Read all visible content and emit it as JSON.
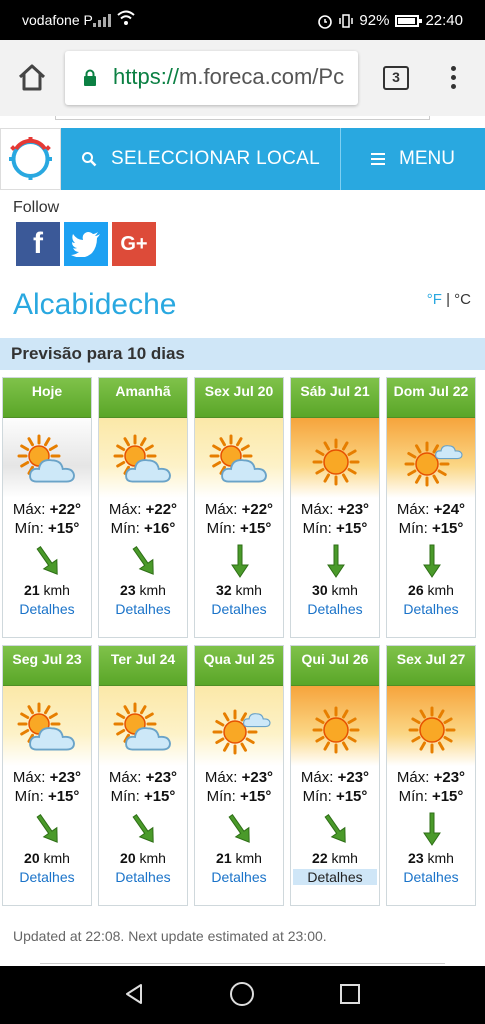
{
  "status": {
    "carrier": "vodafone P",
    "battery": "92%",
    "time": "22:40"
  },
  "browser": {
    "url_scheme": "https://",
    "url_host": "m.foreca.com/Pc",
    "tab_count": "3"
  },
  "site": {
    "select_location": "SELECCIONAR LOCAL",
    "menu": "MENU",
    "follow": "Follow",
    "social": {
      "facebook": "f",
      "google": "G+"
    },
    "city": "Alcabideche",
    "unit_f": "°F",
    "unit_sep": " | ",
    "unit_c": "°C",
    "section_title": "Previsão para 10 dias",
    "max_label": "Máx:",
    "min_label": "Mín:",
    "speed_unit": "kmh",
    "details": "Detalhes",
    "updated": "Updated at 22:08. Next update estimated at 23:00."
  },
  "forecast": [
    {
      "day": "Hoje",
      "max": "+22°",
      "min": "+15°",
      "wind": "21",
      "icon": "partly-cloudy-icon",
      "sky": "cloudy",
      "wind_dir": "nw"
    },
    {
      "day": "Amanhã",
      "max": "+22°",
      "min": "+16°",
      "wind": "23",
      "icon": "partly-cloudy-icon",
      "sky": "partly",
      "wind_dir": "nw"
    },
    {
      "day": "Sex Jul 20",
      "max": "+22°",
      "min": "+15°",
      "wind": "32",
      "icon": "partly-cloudy-icon",
      "sky": "partly",
      "wind_dir": "n"
    },
    {
      "day": "Sáb Jul 21",
      "max": "+23°",
      "min": "+15°",
      "wind": "30",
      "icon": "sunny-icon",
      "sky": "sunny",
      "wind_dir": "n"
    },
    {
      "day": "Dom Jul 22",
      "max": "+24°",
      "min": "+15°",
      "wind": "26",
      "icon": "mostly-sunny-icon",
      "sky": "sunny",
      "wind_dir": "n"
    },
    {
      "day": "Seg Jul 23",
      "max": "+23°",
      "min": "+15°",
      "wind": "20",
      "icon": "partly-cloudy-icon",
      "sky": "partly",
      "wind_dir": "nw"
    },
    {
      "day": "Ter Jul 24",
      "max": "+23°",
      "min": "+15°",
      "wind": "20",
      "icon": "partly-cloudy-icon",
      "sky": "partly",
      "wind_dir": "nw"
    },
    {
      "day": "Qua Jul 25",
      "max": "+23°",
      "min": "+15°",
      "wind": "21",
      "icon": "mostly-sunny-icon",
      "sky": "partly",
      "wind_dir": "nw"
    },
    {
      "day": "Qui Jul 26",
      "max": "+23°",
      "min": "+15°",
      "wind": "22",
      "icon": "sunny-icon",
      "sky": "sunny",
      "wind_dir": "nw"
    },
    {
      "day": "Sex Jul 27",
      "max": "+23°",
      "min": "+15°",
      "wind": "23",
      "icon": "sunny-icon",
      "sky": "sunny",
      "wind_dir": "n"
    }
  ],
  "selected_details_index": 8,
  "colors": {
    "brand_blue": "#29a8e0",
    "header_green": "#5aa628",
    "link_blue": "#1a73c9",
    "wind_arrow": "#4a9a2a"
  }
}
